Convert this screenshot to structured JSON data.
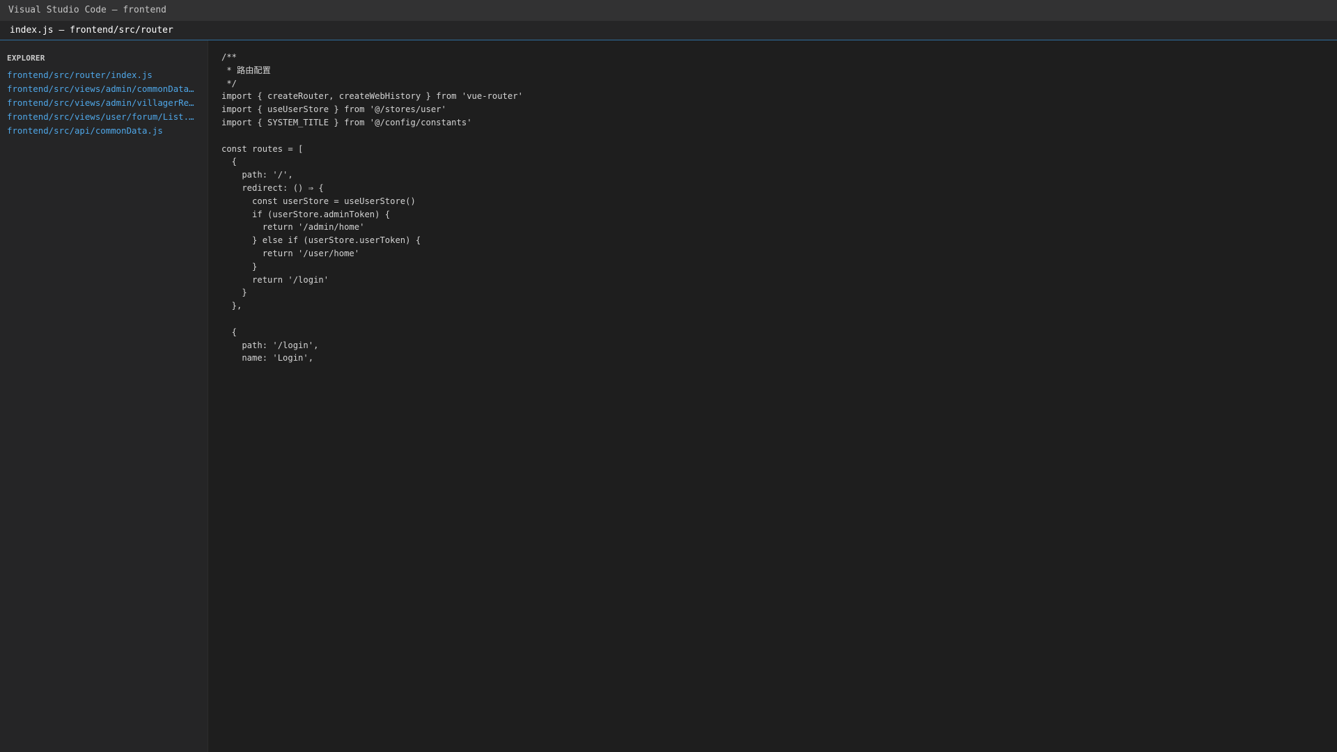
{
  "window": {
    "title": "Visual Studio Code — frontend"
  },
  "tabs": [
    {
      "label": "index.js — frontend/src/router"
    }
  ],
  "sidebar": {
    "title": "EXPLORER",
    "files": [
      "frontend/src/router/index.js",
      "frontend/src/views/admin/commonData/List.vue",
      "frontend/src/views/admin/villagerReport/List.vue",
      "frontend/src/views/user/forum/List.vue",
      "frontend/src/api/commonData.js"
    ]
  },
  "editor": {
    "lines": [
      "/**",
      " * 路由配置",
      " */",
      "import { createRouter, createWebHistory } from 'vue-router'",
      "import { useUserStore } from '@/stores/user'",
      "import { SYSTEM_TITLE } from '@/config/constants'",
      "",
      "const routes = [",
      "  {",
      "    path: '/',",
      "    redirect: () ⇒ {",
      "      const userStore = useUserStore()",
      "      if (userStore.adminToken) {",
      "        return '/admin/home'",
      "      } else if (userStore.userToken) {",
      "        return '/user/home'",
      "      }",
      "      return '/login'",
      "    }",
      "  },",
      "",
      "  {",
      "    path: '/login',",
      "    name: 'Login',"
    ]
  },
  "colors": {
    "titlebar_bg": "#323233",
    "sidebar_bg": "#252526",
    "editor_bg": "#1e1e1e",
    "file_link": "#4fa7e8",
    "tab_border": "#2f6f9f"
  }
}
